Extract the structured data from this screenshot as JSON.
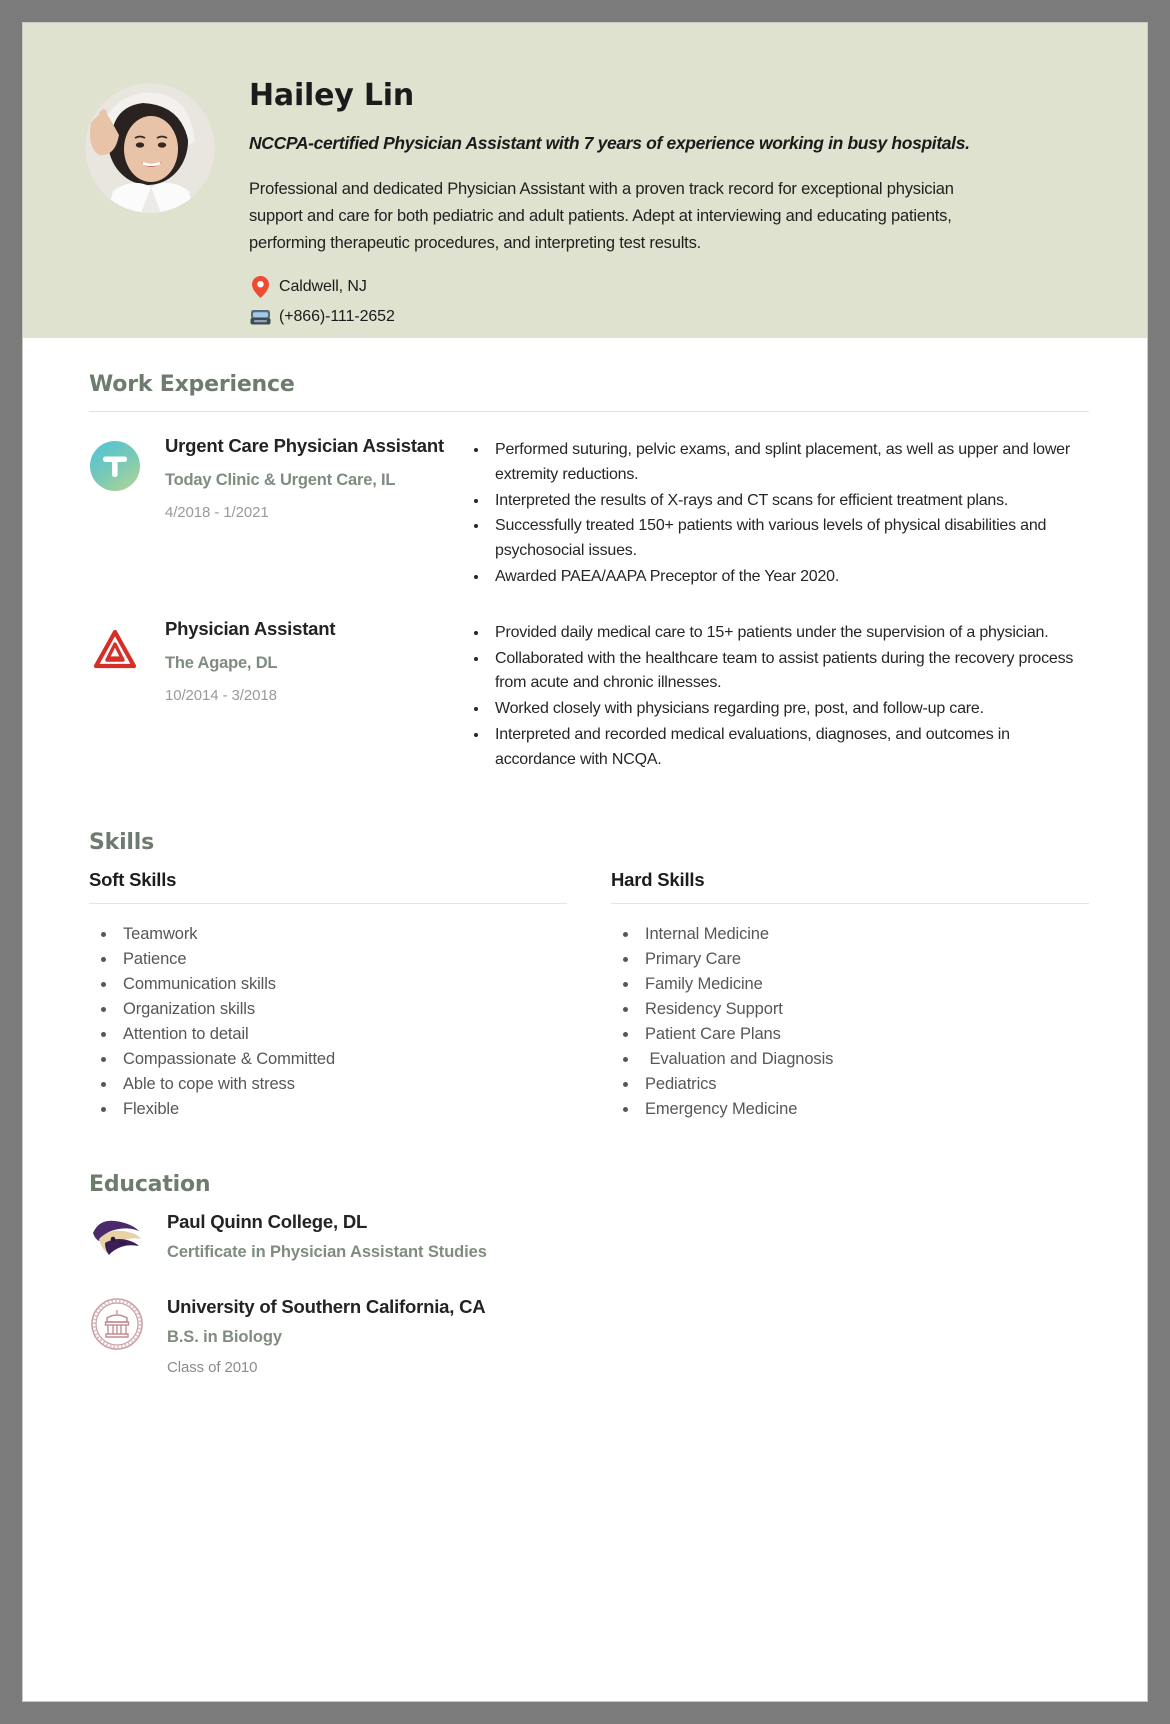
{
  "theme": {
    "header_bg": "#dfe2cf",
    "page_bg": "#7b7b7b",
    "accent_heading": "#6e7c6e",
    "muted_text": "#9a9a9a",
    "body_text": "#262626"
  },
  "header": {
    "name": "Hailey Lin",
    "tagline": "NCCPA-certified Physician Assistant with 7 years of experience working in busy hospitals.",
    "summary": "Professional and dedicated Physician Assistant with a proven track record for exceptional physician support and care for both pediatric and adult patients. Adept at interviewing and educating patients, performing therapeutic procedures, and interpreting test results.",
    "location": "Caldwell, NJ",
    "phone": "(+866)-111-2652",
    "location_icon": "map-pin-icon",
    "phone_icon": "telephone-icon",
    "avatar_alt": "profile-photo"
  },
  "work": {
    "title": "Work Experience",
    "jobs": [
      {
        "logo": "today-clinic-logo",
        "title": "Urgent Care Physician Assistant",
        "company": "Today Clinic & Urgent Care, IL",
        "dates": "4/2018 - 1/2021",
        "bullets": [
          "Performed suturing, pelvic exams, and splint placement, as well as upper and lower extremity reductions.",
          "Interpreted the results of X-rays and CT scans for efficient treatment plans.",
          "Successfully treated 150+ patients with various levels of physical disabilities and psychosocial issues.",
          "Awarded PAEA/AAPA Preceptor of the Year 2020."
        ]
      },
      {
        "logo": "agape-logo",
        "title": "Physician Assistant",
        "company": "The Agape, DL",
        "dates": "10/2014 - 3/2018",
        "bullets": [
          "Provided daily medical care to 15+ patients under the supervision of a physician.",
          "Collaborated with the healthcare team to assist patients during the recovery process from acute and chronic illnesses.",
          "Worked closely with physicians regarding pre, post, and follow-up care.",
          "Interpreted and recorded medical evaluations, diagnoses, and outcomes in accordance with NCQA."
        ]
      }
    ]
  },
  "skills": {
    "title": "Skills",
    "soft": {
      "label": "Soft Skills",
      "items": [
        "Teamwork",
        "Patience",
        "Communication skills",
        "Organization skills",
        "Attention to detail",
        "Compassionate & Committed",
        "Able to cope with stress",
        "Flexible"
      ]
    },
    "hard": {
      "label": "Hard Skills",
      "items": [
        "Internal Medicine",
        "Primary Care",
        "Family Medicine",
        "Residency Support",
        "Patient Care Plans",
        " Evaluation and Diagnosis",
        "Pediatrics",
        "Emergency Medicine"
      ]
    }
  },
  "education": {
    "title": "Education",
    "items": [
      {
        "logo": "paul-quinn-college-logo",
        "school": "Paul Quinn College, DL",
        "degree": "Certificate in Physician Assistant Studies",
        "year": ""
      },
      {
        "logo": "usc-logo",
        "school": "University of Southern California, CA",
        "degree": "B.S. in Biology",
        "year": "Class of 2010"
      }
    ]
  }
}
